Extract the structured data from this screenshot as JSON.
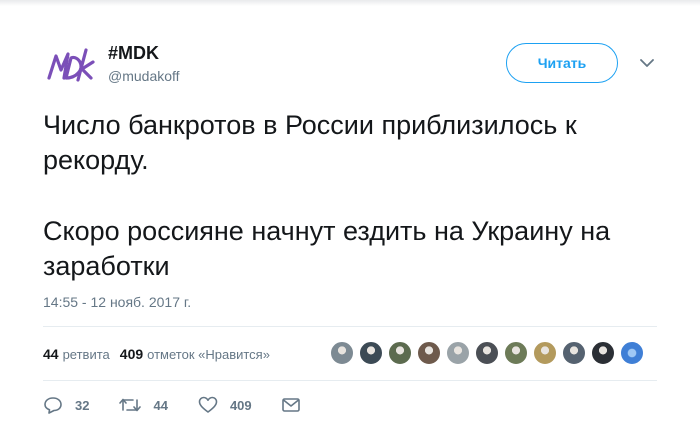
{
  "header": {
    "account_name": "#MDK",
    "account_handle": "@mudakoff",
    "follow_label": "Читать"
  },
  "tweet": {
    "paragraphs": [
      "Число банкротов в России приблизилось к рекорду.",
      "Скоро россияне начнут ездить на Украину на заработки"
    ],
    "timestamp": "14:55 - 12 нояб. 2017 г."
  },
  "stats": {
    "retweets_count": "44",
    "retweets_label": "ретвита",
    "likes_count": "409",
    "likes_label": "отметок «Нравится»"
  },
  "likers": [
    "#7d8a93",
    "#3c4a55",
    "#5c6b4f",
    "#6e5a4c",
    "#9aa3a8",
    "#4b4f55",
    "#6d7b58",
    "#b39a5d",
    "#556270",
    "#2b2f35",
    "#3f7fd6"
  ],
  "actions": {
    "replies": "32",
    "retweets": "44",
    "likes": "409"
  },
  "colors": {
    "accent": "#1da1f2",
    "muted": "#657786",
    "text": "#14171a",
    "logo": "#7b4fb8"
  }
}
